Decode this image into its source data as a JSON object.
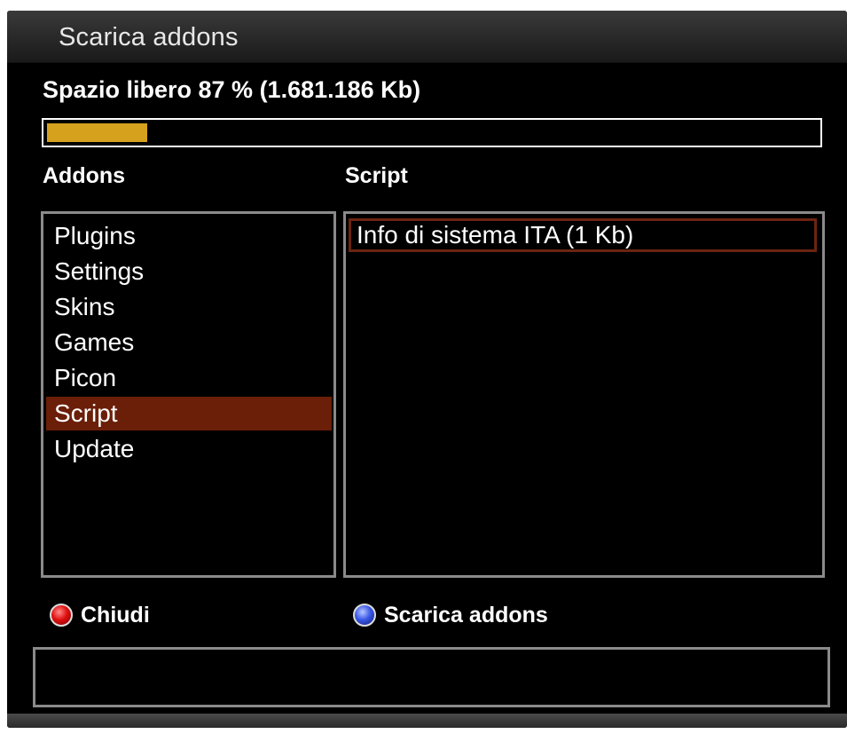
{
  "window": {
    "title": "Scarica addons"
  },
  "storage": {
    "free_space_label": "Spazio libero 87 % (1.681.186 Kb)",
    "used_fraction": 0.13,
    "bar_color": "#d6a21e"
  },
  "columns": {
    "left_header": "Addons",
    "right_header": "Script"
  },
  "addons": {
    "items": [
      {
        "label": "Plugins"
      },
      {
        "label": "Settings"
      },
      {
        "label": "Skins"
      },
      {
        "label": "Games"
      },
      {
        "label": "Picon"
      },
      {
        "label": "Script"
      },
      {
        "label": "Update"
      }
    ],
    "selected_index": 5,
    "selected_color": "#6b1e08"
  },
  "scripts": {
    "items": [
      {
        "label": "Info di sistema ITA (1 Kb)"
      }
    ],
    "selected_index": 0
  },
  "buttons": {
    "close": {
      "label": "Chiudi",
      "icon": "red-button-icon",
      "color": "#e01010"
    },
    "download": {
      "label": "Scarica addons",
      "icon": "blue-button-icon",
      "color": "#3a58e8"
    }
  },
  "status": {
    "text": ""
  }
}
